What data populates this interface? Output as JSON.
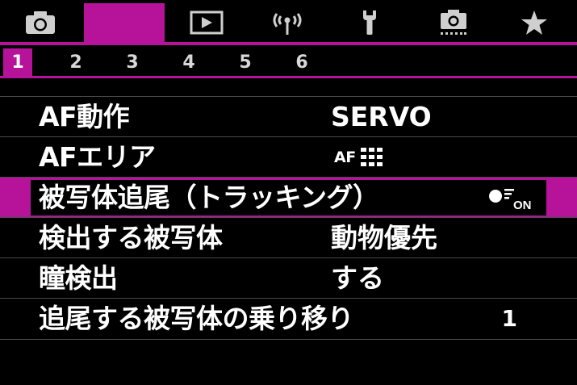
{
  "colors": {
    "accent": "#b6129a",
    "background": "#000000",
    "text": "#ffffff",
    "divider": "#4a4a4a"
  },
  "tabs": [
    {
      "icon": "camera-icon",
      "active": false
    },
    {
      "icon": "af-tab",
      "active": true
    },
    {
      "icon": "playback-icon",
      "active": false
    },
    {
      "icon": "wireless-icon",
      "active": false
    },
    {
      "icon": "wrench-icon",
      "active": false
    },
    {
      "icon": "custom-camera-icon",
      "active": false
    },
    {
      "icon": "star-icon",
      "active": false
    }
  ],
  "pages": [
    "1",
    "2",
    "3",
    "4",
    "5",
    "6"
  ],
  "active_page": "1",
  "menu": {
    "items": [
      {
        "label": "AF動作",
        "value": "SERVO"
      },
      {
        "label": "AFエリア",
        "value_icon_text": "AF"
      },
      {
        "label": "被写体追尾（トラッキング）",
        "value_icon_text": "ON"
      },
      {
        "label": "検出する被写体",
        "value": "動物優先"
      },
      {
        "label": "瞳検出",
        "value": "する"
      },
      {
        "label": "追尾する被写体の乗り移り",
        "value": "1"
      }
    ],
    "selected_index": 2
  }
}
